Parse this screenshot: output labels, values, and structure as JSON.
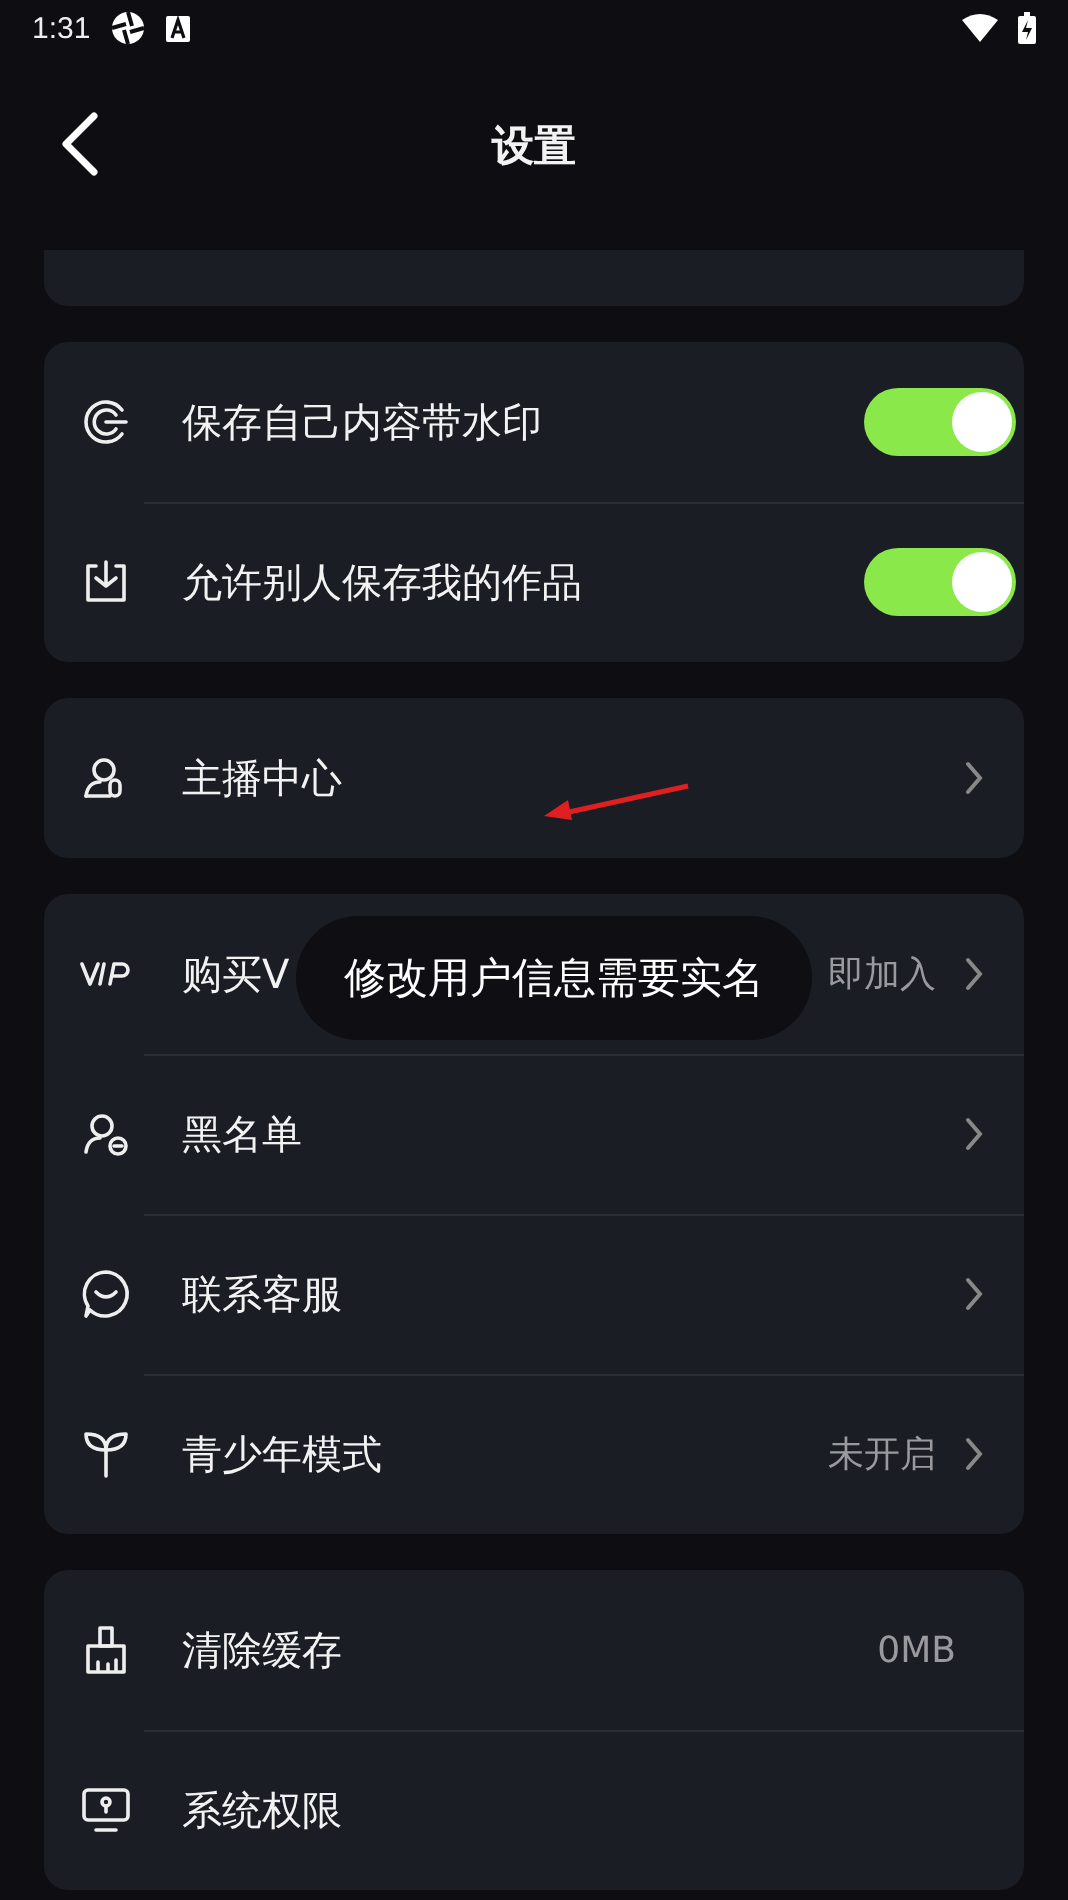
{
  "status_bar": {
    "time": "1:31"
  },
  "header": {
    "title": "设置"
  },
  "groups": [
    {
      "items": [
        {
          "kind": "toggle",
          "label": "保存自己内容带水印",
          "on": true
        },
        {
          "kind": "toggle",
          "label": "允许别人保存我的作品",
          "on": true
        }
      ]
    },
    {
      "items": [
        {
          "kind": "link",
          "label": "主播中心"
        }
      ]
    },
    {
      "items": [
        {
          "kind": "link",
          "label": "购买V",
          "value": "即加入"
        },
        {
          "kind": "link",
          "label": "黑名单"
        },
        {
          "kind": "link",
          "label": "联系客服"
        },
        {
          "kind": "link",
          "label": "青少年模式",
          "value": "未开启"
        }
      ]
    },
    {
      "items": [
        {
          "kind": "info",
          "label": "清除缓存",
          "value": "0MB"
        },
        {
          "kind": "info",
          "label": "系统权限"
        }
      ]
    }
  ],
  "toast": {
    "text": "修改用户信息需要实名"
  }
}
